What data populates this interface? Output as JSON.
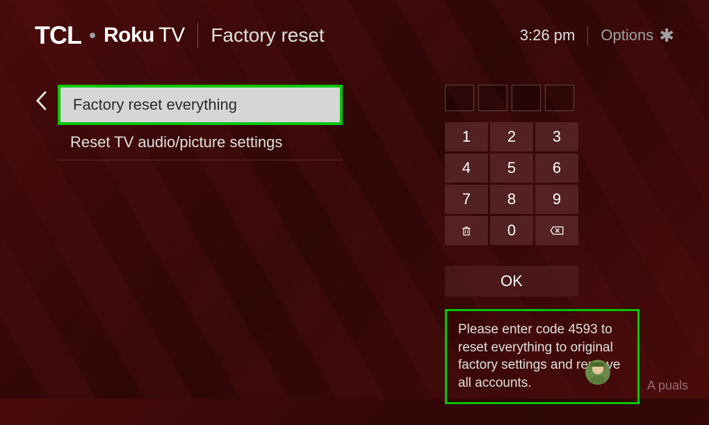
{
  "header": {
    "tcl_logo": "TCL",
    "roku_logo": "Roku",
    "tv_text": "TV",
    "page_title": "Factory reset",
    "time": "3:26  pm",
    "options_label": "Options"
  },
  "menu": {
    "items": [
      {
        "label": "Factory reset everything",
        "selected": true
      },
      {
        "label": "Reset TV audio/picture settings",
        "selected": false
      }
    ]
  },
  "keypad": {
    "keys": [
      "1",
      "2",
      "3",
      "4",
      "5",
      "6",
      "7",
      "8",
      "9"
    ],
    "zero": "0",
    "ok_label": "OK"
  },
  "instruction": {
    "text": "Please enter code 4593 to reset everything to original factory settings and remove all accounts."
  },
  "watermark": "A  puals"
}
